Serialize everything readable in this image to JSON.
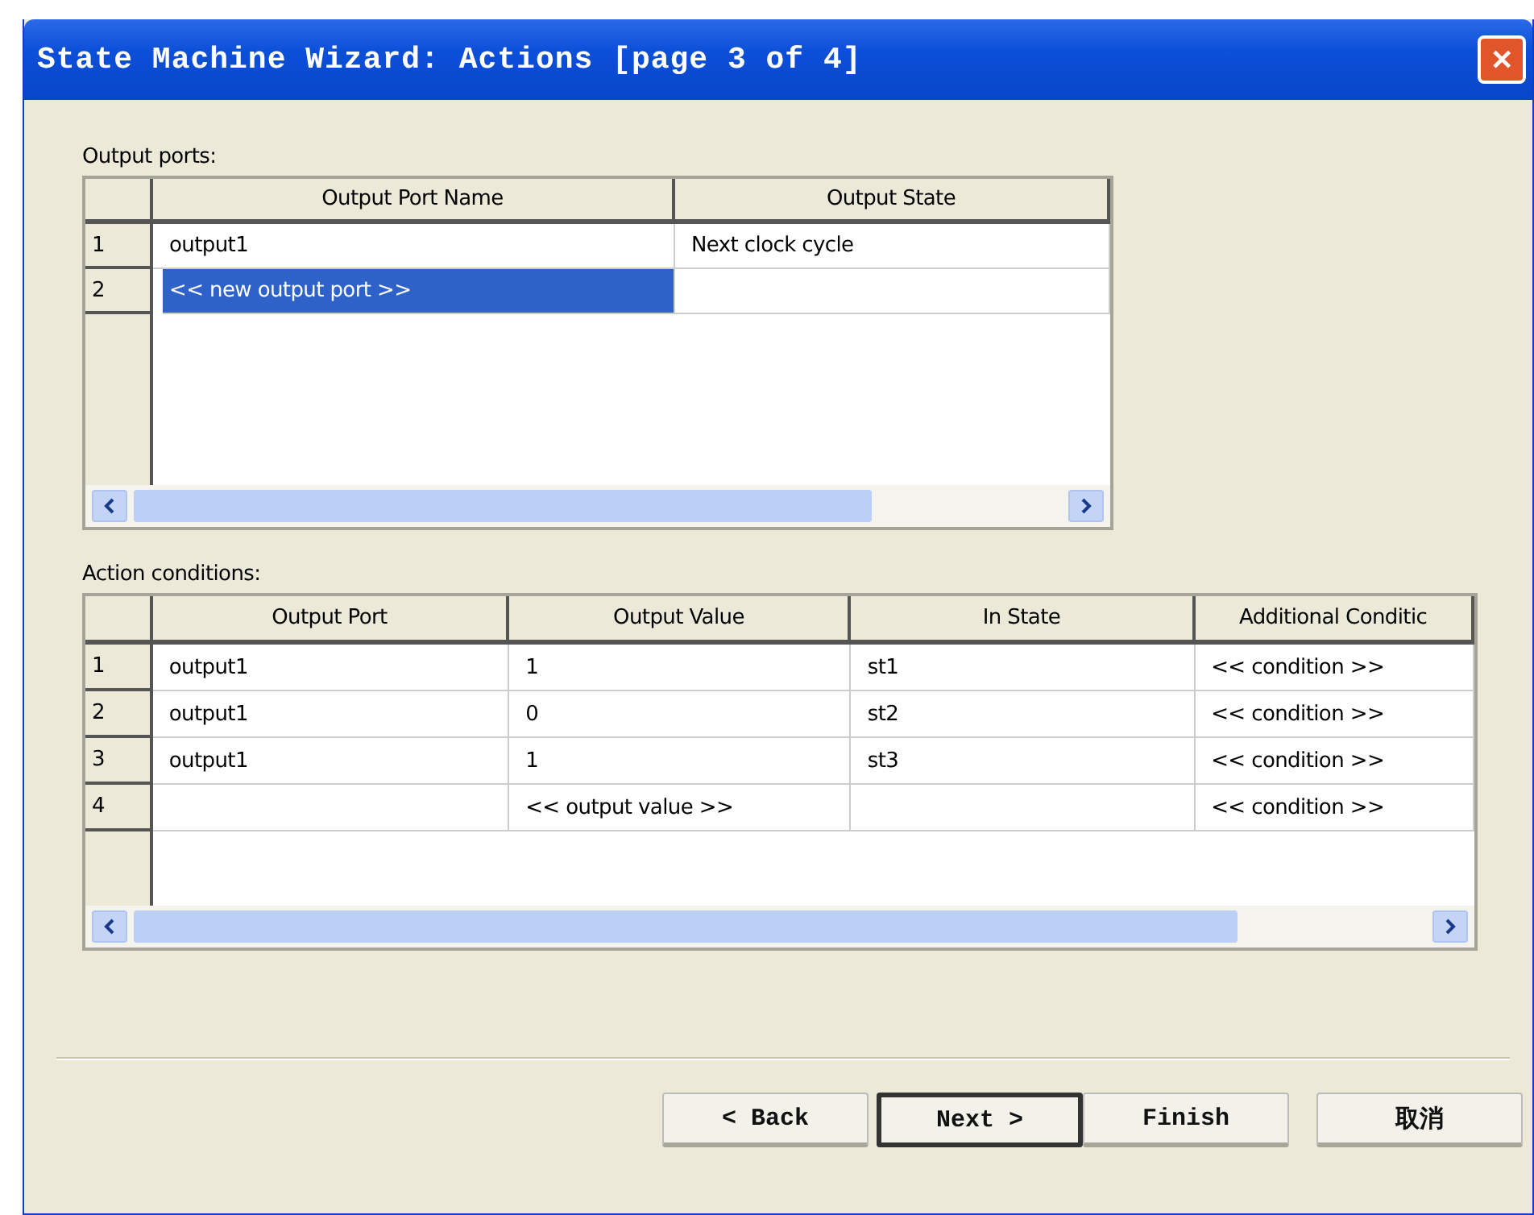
{
  "window": {
    "title": "State Machine Wizard: Actions [page 3 of 4]",
    "close_glyph": "✕"
  },
  "output_ports": {
    "label": "Output ports:",
    "columns": [
      "Output Port Name",
      "Output State"
    ],
    "rows": [
      {
        "number": "1",
        "cells": [
          "output1",
          "Next clock cycle"
        ],
        "selected": false
      },
      {
        "number": "2",
        "cells": [
          "<< new output port >>",
          ""
        ],
        "selected": true
      }
    ]
  },
  "action_conditions": {
    "label": "Action conditions:",
    "columns": [
      "Output Port",
      "Output Value",
      "In State",
      "Additional Conditic"
    ],
    "rows": [
      {
        "number": "1",
        "cells": [
          "output1",
          "1",
          "st1",
          "<< condition >>"
        ],
        "selected": false
      },
      {
        "number": "2",
        "cells": [
          "output1",
          "0",
          "st2",
          "<< condition >>"
        ],
        "selected": false
      },
      {
        "number": "3",
        "cells": [
          "output1",
          "1",
          "st3",
          "<< condition >>"
        ],
        "selected": false
      },
      {
        "number": "4",
        "cells": [
          "",
          "<< output value >>",
          "",
          "<< condition >>"
        ],
        "selected": false
      }
    ]
  },
  "buttons": [
    {
      "label": "< Back",
      "default": false
    },
    {
      "label": "Next >",
      "default": true
    },
    {
      "label": "Finish",
      "default": false
    },
    {
      "label": "取消",
      "default": false
    }
  ]
}
